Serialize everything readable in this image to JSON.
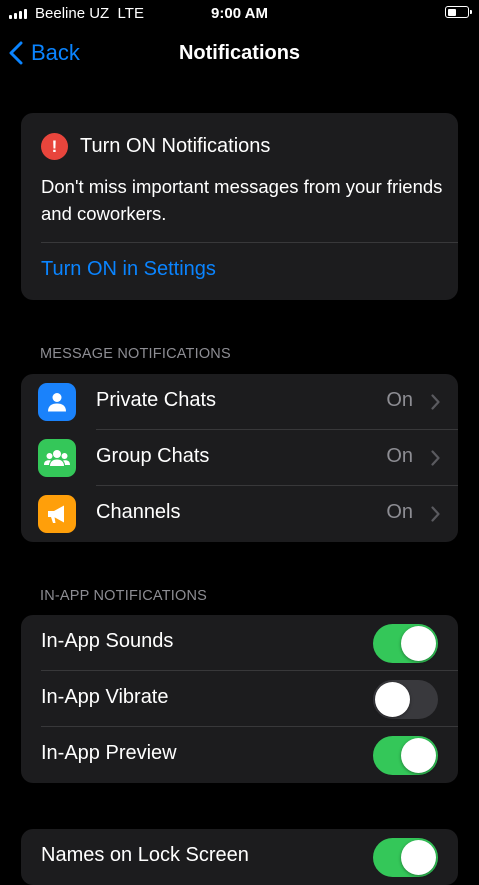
{
  "status_bar": {
    "carrier": "Beeline UZ",
    "network": "LTE",
    "time": "9:00 AM",
    "battery_level": 0.45
  },
  "nav": {
    "back_label": "Back",
    "title": "Notifications"
  },
  "banner": {
    "title": "Turn ON Notifications",
    "body": "Don't miss important messages from your friends and coworkers.",
    "link": "Turn ON in Settings"
  },
  "message_section": {
    "header": "MESSAGE NOTIFICATIONS",
    "items": [
      {
        "label": "Private Chats",
        "value": "On",
        "icon": "person-icon",
        "color": "#1a82fb"
      },
      {
        "label": "Group Chats",
        "value": "On",
        "icon": "group-icon",
        "color": "#34c759"
      },
      {
        "label": "Channels",
        "value": "On",
        "icon": "megaphone-icon",
        "color": "#ff9f0a"
      }
    ]
  },
  "inapp_section": {
    "header": "IN-APP NOTIFICATIONS",
    "items": [
      {
        "label": "In-App Sounds",
        "enabled": true
      },
      {
        "label": "In-App Vibrate",
        "enabled": false
      },
      {
        "label": "In-App Preview",
        "enabled": true
      }
    ]
  },
  "lock_section": {
    "items": [
      {
        "label": "Names on Lock Screen",
        "enabled": true
      }
    ]
  },
  "colors": {
    "accent": "#0a84ff",
    "toggle_on": "#34c759",
    "alert": "#e8453c"
  }
}
